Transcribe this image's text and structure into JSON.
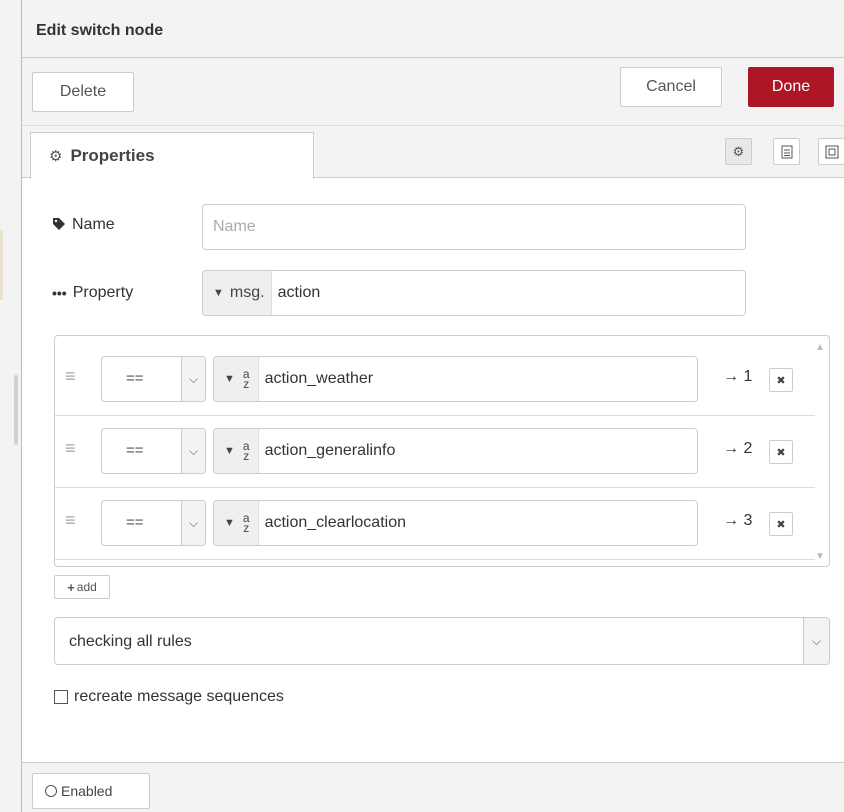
{
  "header": {
    "title": "Edit switch node"
  },
  "toolbar": {
    "delete_label": "Delete",
    "cancel_label": "Cancel",
    "done_label": "Done"
  },
  "tabs": [
    {
      "label": "Properties",
      "icon": "gear-icon"
    }
  ],
  "tab_buttons": [
    "gear-icon",
    "description-icon",
    "appearance-icon"
  ],
  "form": {
    "name_label": "Name",
    "name_placeholder": "Name",
    "name_value": "",
    "property_label": "Property",
    "property_type": "msg.",
    "property_value": "action"
  },
  "rules": [
    {
      "operator": "==",
      "value_type": "az",
      "value": "action_weather",
      "output": "→ 1"
    },
    {
      "operator": "==",
      "value_type": "az",
      "value": "action_generalinfo",
      "output": "→ 2"
    },
    {
      "operator": "==",
      "value_type": "az",
      "value": "action_clearlocation",
      "output": "→ 3"
    }
  ],
  "add_label": "add",
  "checking_mode": "checking all rules",
  "recreate_label": "recreate message sequences",
  "footer": {
    "enabled_label": "Enabled"
  },
  "colors": {
    "done": "#ad1625",
    "panel": "#f3f3f3",
    "border": "#cccccc"
  }
}
